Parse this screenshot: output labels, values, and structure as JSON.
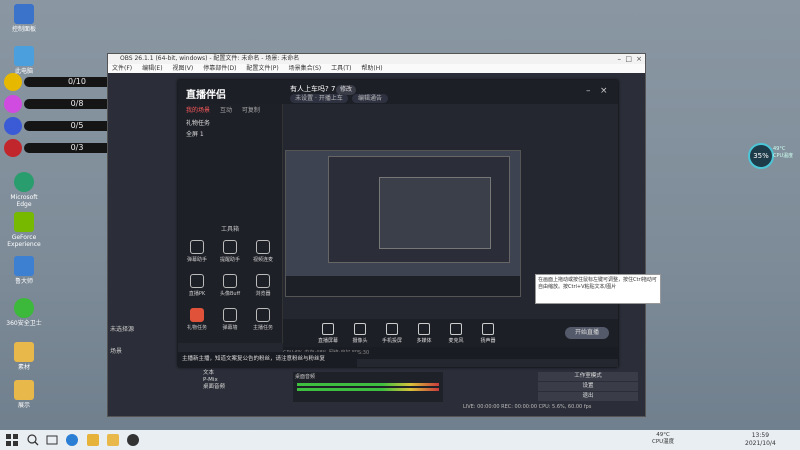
{
  "desktop": {
    "icons": [
      {
        "label": "控制面板"
      },
      {
        "label": "此电脑"
      },
      {
        "label": "Microsoft Edge"
      },
      {
        "label": "GeForce Experience"
      },
      {
        "label": "鲁大师"
      },
      {
        "label": "360安全卫士"
      },
      {
        "label": "素材"
      },
      {
        "label": "展示"
      }
    ],
    "counters": [
      {
        "value": "0/10",
        "color": "#e6b900"
      },
      {
        "value": "0/8",
        "color": "#d04be0"
      },
      {
        "value": "0/5",
        "color": "#3b5bd6"
      },
      {
        "value": "0/3",
        "color": "#c0262b"
      }
    ],
    "cpu_widget": {
      "percent": "35%",
      "temp": "49°C",
      "label": "CPU温度"
    }
  },
  "obs": {
    "title": "OBS 26.1.1 (64-bit, windows) - 配置文件: 未命名 - 场景: 未命名",
    "menu": [
      "文件(F)",
      "编辑(E)",
      "视图(V)",
      "停靠部件(D)",
      "配置文件(P)",
      "场景集合(S)",
      "工具(T)",
      "帮助(H)"
    ],
    "scene_label": "未选择源",
    "scenes_header": "场景",
    "sources_header": "来源",
    "sources": [
      {
        "name": "文本"
      },
      {
        "name": "P-Mix"
      },
      {
        "name": "桌面音频"
      }
    ],
    "mixer_label": "桌面音频",
    "controls": [
      "工作室模式",
      "设置",
      "退出"
    ],
    "statusbar": "LIVE: 00:00:00   REC: 00:00:00   CPU: 5.6%, 60.00 fps"
  },
  "app": {
    "name": "直播伴侣",
    "subtitle": "有人上车吗? 7",
    "edit_label": "修改",
    "tag1": "未设置 · 开播上车",
    "tag2": "编辑通告",
    "tabs": [
      "我的场景",
      "互动",
      "可复制"
    ],
    "scene_items": [
      "礼物任务",
      "全屏 1"
    ],
    "tools_title": "工具箱",
    "tools": [
      "弹幕助手",
      "提醒助手",
      "视频连麦",
      "直播PK",
      "头像Buff",
      "浏览器",
      "礼物任务",
      "弹幕墙",
      "主播任务"
    ],
    "bottom_buttons": [
      "直播屏幕",
      "摄像头",
      "手机投屏",
      "多媒体",
      "麦克风",
      "扬声器"
    ],
    "start_button": "开始直播",
    "notice": "主播新主播，知道文案复公告的粉丝，请注意粉丝与粉丝复",
    "tooltip": "在画面上拖动或按住鼠标左键可调整，按住Ctrl拖动可自由缩放。按Ctrl+V粘贴文本/图片",
    "status": "CPU:6%  内存:48%  网络:良好  FPS:30"
  },
  "taskbar": {
    "temp": "49°C",
    "temp_label": "CPU温度",
    "time": "13:59",
    "date": "2021/10/4"
  }
}
